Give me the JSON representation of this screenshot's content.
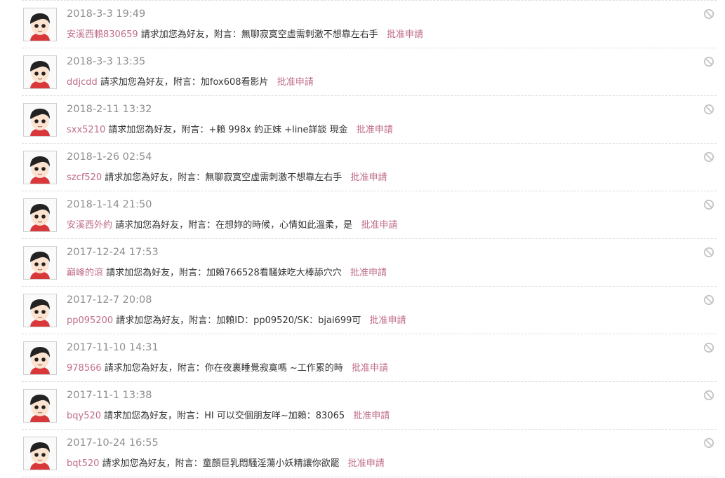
{
  "requests": [
    {
      "time": "2018-3-3 19:49",
      "user": "安溪西賴830659",
      "text": "請求加您為好友，附言：無聊寂寞空虛需刺激不想靠左右手",
      "action": "批准申請"
    },
    {
      "time": "2018-3-3 13:35",
      "user": "ddjcdd",
      "text": "請求加您為好友，附言：加fox608看影片",
      "action": "批准申請"
    },
    {
      "time": "2018-2-11 13:32",
      "user": "sxx5210",
      "text": "請求加您為好友，附言：+賴 998x 約正妹 +line詳談 現金",
      "action": "批准申請"
    },
    {
      "time": "2018-1-26 02:54",
      "user": "szcf520",
      "text": "請求加您為好友，附言：無聊寂寞空虛需刺激不想靠左右手",
      "action": "批准申請"
    },
    {
      "time": "2018-1-14 21:50",
      "user": "安溪西外約",
      "text": "請求加您為好友，附言：在想妳的時候，心情如此溫柔，是",
      "action": "批准申請"
    },
    {
      "time": "2017-12-24 17:53",
      "user": "巔峰的滾",
      "text": "請求加您為好友，附言：加賴766528看騷妹吃大棒舔穴穴",
      "action": "批准申請"
    },
    {
      "time": "2017-12-7 20:08",
      "user": "pp095200",
      "text": "請求加您為好友，附言：加賴ID：pp09520/SK：bjai699可",
      "action": "批准申請"
    },
    {
      "time": "2017-11-10 14:31",
      "user": "978566",
      "text": "請求加您為好友，附言：你在夜裏睡覺寂寞嗎 ~工作累的時",
      "action": "批准申請"
    },
    {
      "time": "2017-11-1 13:38",
      "user": "bqy520",
      "text": "請求加您為好友，附言：HI 可以交個朋友咩~加賴：83065",
      "action": "批准申請"
    },
    {
      "time": "2017-10-24 16:55",
      "user": "bqt520",
      "text": "請求加您為好友，附言：童顏巨乳悶騷淫蕩小妖精讓你欲罷",
      "action": "批准申請"
    }
  ],
  "icons": {
    "avatar": "cartoon-person-avatar-icon",
    "ignore": "ignore-circle-slash-icon"
  },
  "colors": {
    "link": "#c06d8c",
    "timestamp": "#8e8e8e",
    "text": "#333333",
    "divider": "#dcdcdc"
  }
}
